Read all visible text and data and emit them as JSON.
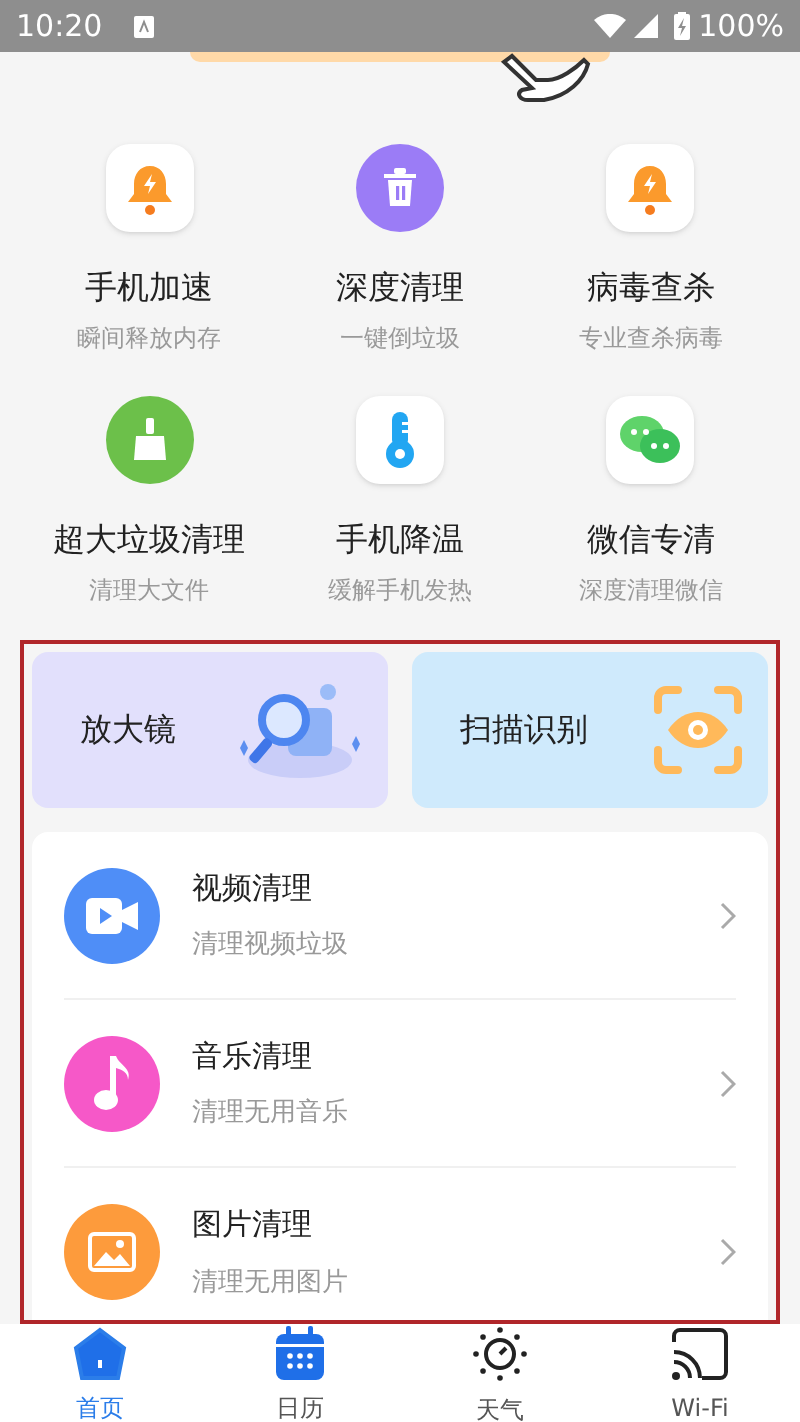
{
  "status_bar": {
    "time": "10:20",
    "battery": "100%"
  },
  "tools": [
    {
      "kind": "bell",
      "title": "手机加速",
      "subtitle": "瞬间释放内存"
    },
    {
      "kind": "trash",
      "title": "深度清理",
      "subtitle": "一键倒垃圾"
    },
    {
      "kind": "bell",
      "title": "病毒查杀",
      "subtitle": "专业查杀病毒"
    },
    {
      "kind": "broom",
      "title": "超大垃圾清理",
      "subtitle": "清理大文件"
    },
    {
      "kind": "thermometer",
      "title": "手机降温",
      "subtitle": "缓解手机发热"
    },
    {
      "kind": "chat",
      "title": "微信专清",
      "subtitle": "深度清理微信"
    }
  ],
  "feature_cards": [
    {
      "kind": "magnifier",
      "title": "放大镜"
    },
    {
      "kind": "scan",
      "title": "扫描识别"
    }
  ],
  "clean_list": [
    {
      "kind": "video",
      "title": "视频清理",
      "subtitle": "清理视频垃圾"
    },
    {
      "kind": "music",
      "title": "音乐清理",
      "subtitle": "清理无用音乐"
    },
    {
      "kind": "image",
      "title": "图片清理",
      "subtitle": "清理无用图片"
    }
  ],
  "tab_bar": [
    {
      "kind": "home",
      "label": "首页",
      "selected": true
    },
    {
      "kind": "calendar",
      "label": "日历",
      "selected": false
    },
    {
      "kind": "weather",
      "label": "天气",
      "selected": false
    },
    {
      "kind": "cast",
      "label": "Wi-Fi",
      "selected": false
    }
  ]
}
